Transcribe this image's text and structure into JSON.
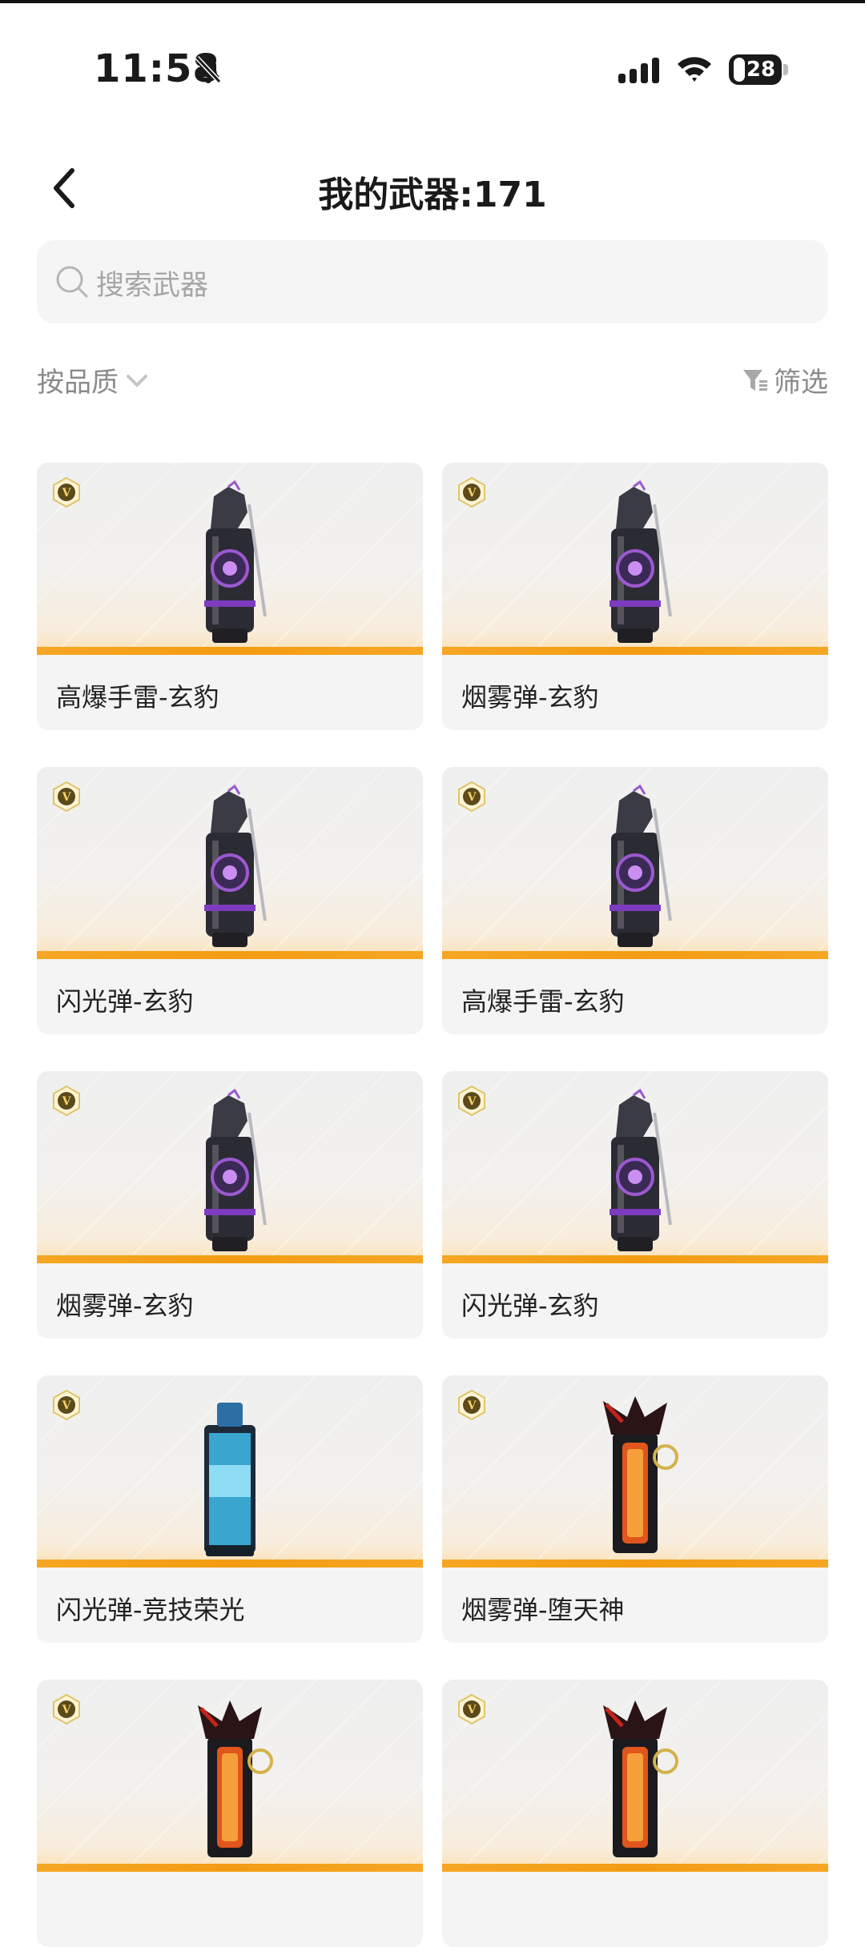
{
  "status_bar": {
    "time": "11:58",
    "battery": "28"
  },
  "header": {
    "title": "我的武器:171"
  },
  "search": {
    "placeholder": "搜索武器"
  },
  "sort": {
    "label": "按品质"
  },
  "filter": {
    "label": "筛选"
  },
  "weapons": [
    {
      "name": "高爆手雷-玄豹",
      "style": "dark"
    },
    {
      "name": "烟雾弹-玄豹",
      "style": "dark"
    },
    {
      "name": "闪光弹-玄豹",
      "style": "dark"
    },
    {
      "name": "高爆手雷-玄豹",
      "style": "dark"
    },
    {
      "name": "烟雾弹-玄豹",
      "style": "dark"
    },
    {
      "name": "闪光弹-玄豹",
      "style": "dark"
    },
    {
      "name": "闪光弹-竞技荣光",
      "style": "blue"
    },
    {
      "name": "烟雾弹-堕天神",
      "style": "red"
    },
    {
      "name": "",
      "style": "red"
    },
    {
      "name": "",
      "style": "red"
    }
  ],
  "colors": {
    "accent_bar": "#f39c12",
    "badge_gold": "#c9a227"
  }
}
